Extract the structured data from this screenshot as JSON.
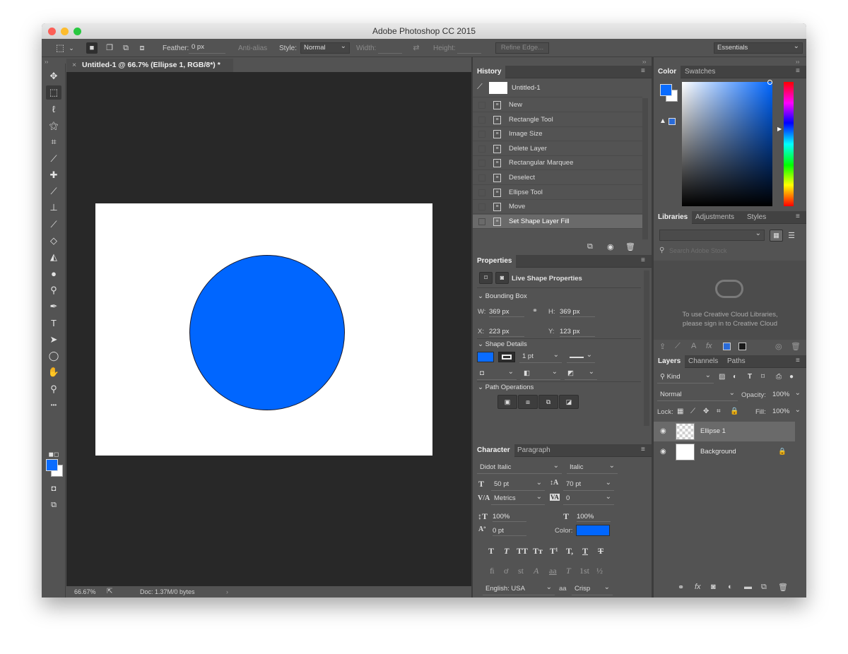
{
  "app": {
    "title": "Adobe Photoshop CC 2015"
  },
  "options_bar": {
    "feather_label": "Feather:",
    "feather_value": "0 px",
    "antialias_label": "Anti-alias",
    "style_label": "Style:",
    "style_value": "Normal",
    "width_label": "Width:",
    "height_label": "Height:",
    "refine_edge": "Refine Edge...",
    "workspace": "Essentials"
  },
  "document": {
    "tab_title": "Untitled-1 @ 66.7% (Ellipse 1, RGB/8*) *",
    "zoom": "66.67%",
    "doc_size": "Doc: 1.37M/0 bytes",
    "ellipse_fill": "#0066ff"
  },
  "tools": [
    {
      "icon": "move-tool-icon",
      "glyph": "✥"
    },
    {
      "icon": "marquee-tool-icon",
      "glyph": "⬚"
    },
    {
      "icon": "lasso-tool-icon",
      "glyph": "ℓ"
    },
    {
      "icon": "magic-wand-tool-icon",
      "glyph": "⚝"
    },
    {
      "icon": "crop-tool-icon",
      "glyph": "⌗"
    },
    {
      "icon": "eyedropper-tool-icon",
      "glyph": "⟋"
    },
    {
      "icon": "healing-brush-tool-icon",
      "glyph": "✚"
    },
    {
      "icon": "brush-tool-icon",
      "glyph": "⟋"
    },
    {
      "icon": "clone-stamp-tool-icon",
      "glyph": "⊥"
    },
    {
      "icon": "history-brush-tool-icon",
      "glyph": "⟋"
    },
    {
      "icon": "eraser-tool-icon",
      "glyph": "◇"
    },
    {
      "icon": "paint-bucket-tool-icon",
      "glyph": "◭"
    },
    {
      "icon": "blur-tool-icon",
      "glyph": "●"
    },
    {
      "icon": "dodge-tool-icon",
      "glyph": "⚲"
    },
    {
      "icon": "pen-tool-icon",
      "glyph": "✒"
    },
    {
      "icon": "type-tool-icon",
      "glyph": "T"
    },
    {
      "icon": "path-selection-tool-icon",
      "glyph": "➤"
    },
    {
      "icon": "ellipse-tool-icon",
      "glyph": "◯"
    },
    {
      "icon": "hand-tool-icon",
      "glyph": "✋"
    },
    {
      "icon": "zoom-tool-icon",
      "glyph": "⚲"
    },
    {
      "icon": "more-tools-icon",
      "glyph": "•••"
    }
  ],
  "colors": {
    "foreground": "#0a6cff",
    "background": "#ffffff",
    "text_color": "#0066ff"
  },
  "history": {
    "tab": "History",
    "snapshot": "Untitled-1",
    "items": [
      "New",
      "Rectangle Tool",
      "Image Size",
      "Delete Layer",
      "Rectangular Marquee",
      "Deselect",
      "Ellipse Tool",
      "Move",
      "Set Shape Layer Fill"
    ]
  },
  "properties": {
    "tab": "Properties",
    "title": "Live Shape Properties",
    "bounding_box": "Bounding Box",
    "w_label": "W:",
    "w_value": "369 px",
    "h_label": "H:",
    "h_value": "369 px",
    "x_label": "X:",
    "x_value": "223 px",
    "y_label": "Y:",
    "y_value": "123 px",
    "shape_details": "Shape Details",
    "stroke_width": "1 pt",
    "path_operations": "Path Operations"
  },
  "character": {
    "tab": "Character",
    "tab2": "Paragraph",
    "font_family": "Didot Italic",
    "font_style": "Italic",
    "font_size": "50 pt",
    "leading": "70 pt",
    "kerning": "Metrics",
    "tracking": "0",
    "vertical_scale": "100%",
    "horizontal_scale": "100%",
    "baseline_shift": "0 pt",
    "color_label": "Color:",
    "language": "English: USA",
    "aa_label": "a",
    "antialias": "Crisp"
  },
  "color_panel": {
    "tab": "Color",
    "tab2": "Swatches"
  },
  "libraries": {
    "tab": "Libraries",
    "tab2": "Adjustments",
    "tab3": "Styles",
    "search_placeholder": "Search Adobe Stock",
    "signin_line1": "To use Creative Cloud Libraries,",
    "signin_line2": "please sign in to Creative Cloud"
  },
  "layers": {
    "tab": "Layers",
    "tab2": "Channels",
    "tab3": "Paths",
    "kind": "Kind",
    "blend_mode": "Normal",
    "opacity_label": "Opacity:",
    "opacity": "100%",
    "lock_label": "Lock:",
    "fill_label": "Fill:",
    "fill": "100%",
    "items": [
      {
        "name": "Ellipse 1"
      },
      {
        "name": "Background"
      }
    ]
  }
}
